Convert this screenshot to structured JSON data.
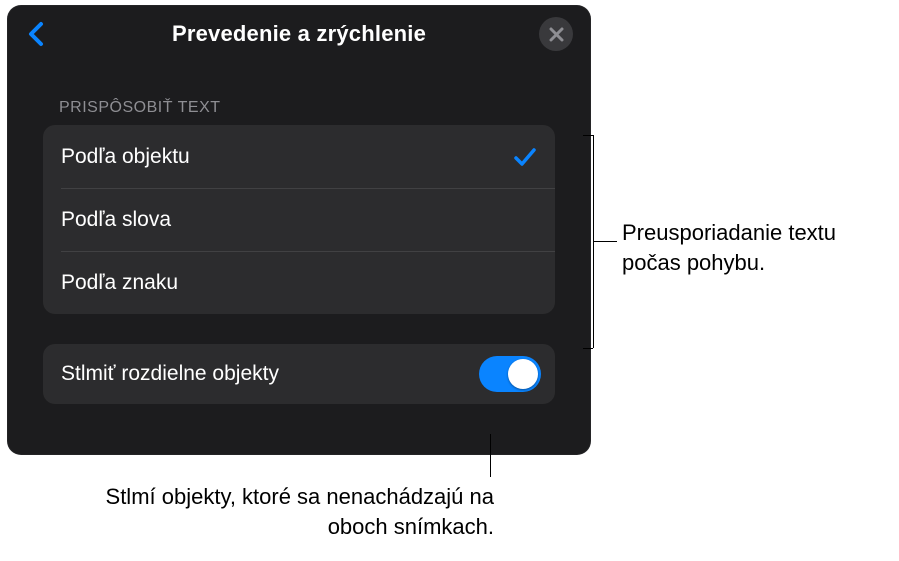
{
  "header": {
    "title": "Prevedenie a zrýchlenie"
  },
  "section": {
    "title": "Prispôsobiť text"
  },
  "options": [
    {
      "label": "Podľa objektu",
      "checked": true
    },
    {
      "label": "Podľa slova",
      "checked": false
    },
    {
      "label": "Podľa znaku",
      "checked": false
    }
  ],
  "toggle": {
    "label": "Stlmiť rozdielne objekty",
    "on": true
  },
  "annotations": {
    "right": "Preusporiadanie textu počas pohybu.",
    "bottom": "Stlmí objekty, ktoré sa nenachádzajú na oboch snímkach."
  },
  "colors": {
    "accent": "#0a84ff",
    "panel_bg": "#1c1c1e",
    "cell_bg": "#2c2c2e"
  }
}
